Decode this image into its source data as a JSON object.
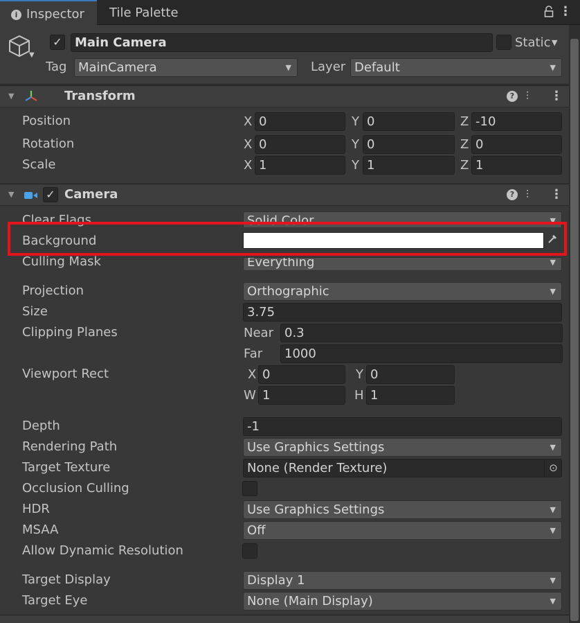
{
  "tabs": [
    {
      "label": "Inspector",
      "active": true,
      "icon": "info-icon"
    },
    {
      "label": "Tile Palette",
      "active": false
    }
  ],
  "tab_actions": {
    "lock_icon": "lock-icon",
    "menu_icon": "kebab-icon"
  },
  "header": {
    "object_icon": "cube-icon",
    "active": true,
    "name": "Main Camera",
    "static_label": "Static",
    "static_checked": false,
    "tag_label": "Tag",
    "tag_value": "MainCamera",
    "layer_label": "Layer",
    "layer_value": "Default"
  },
  "transform": {
    "title": "Transform",
    "rows": [
      {
        "label": "Position",
        "x": "0",
        "y": "0",
        "z": "-10"
      },
      {
        "label": "Rotation",
        "x": "0",
        "y": "0",
        "z": "0"
      },
      {
        "label": "Scale",
        "x": "1",
        "y": "1",
        "z": "1"
      }
    ],
    "axis": {
      "x": "X",
      "y": "Y",
      "z": "Z"
    }
  },
  "camera": {
    "title": "Camera",
    "enabled": true,
    "clear_flags": {
      "label": "Clear Flags",
      "value": "Solid Color"
    },
    "background": {
      "label": "Background",
      "color": "#ffffff"
    },
    "culling_mask": {
      "label": "Culling Mask",
      "value": "Everything"
    },
    "projection": {
      "label": "Projection",
      "value": "Orthographic"
    },
    "size": {
      "label": "Size",
      "value": "3.75"
    },
    "clipping": {
      "label": "Clipping Planes",
      "near_label": "Near",
      "near": "0.3",
      "far_label": "Far",
      "far": "1000"
    },
    "viewport": {
      "label": "Viewport Rect",
      "x_label": "X",
      "x": "0",
      "y_label": "Y",
      "y": "0",
      "w_label": "W",
      "w": "1",
      "h_label": "H",
      "h": "1"
    },
    "depth": {
      "label": "Depth",
      "value": "-1"
    },
    "rendering_path": {
      "label": "Rendering Path",
      "value": "Use Graphics Settings"
    },
    "target_texture": {
      "label": "Target Texture",
      "value": "None (Render Texture)"
    },
    "occlusion": {
      "label": "Occlusion Culling",
      "checked": false
    },
    "hdr": {
      "label": "HDR",
      "value": "Use Graphics Settings"
    },
    "msaa": {
      "label": "MSAA",
      "value": "Off"
    },
    "dynamic_res": {
      "label": "Allow Dynamic Resolution",
      "checked": false
    },
    "target_display": {
      "label": "Target Display",
      "value": "Display 1"
    },
    "target_eye": {
      "label": "Target Eye",
      "value": "None (Main Display)"
    }
  },
  "colors": {
    "highlight": "#e3141b",
    "accent_tab": "#3a79bb",
    "background_swatch": "#ffffff"
  }
}
